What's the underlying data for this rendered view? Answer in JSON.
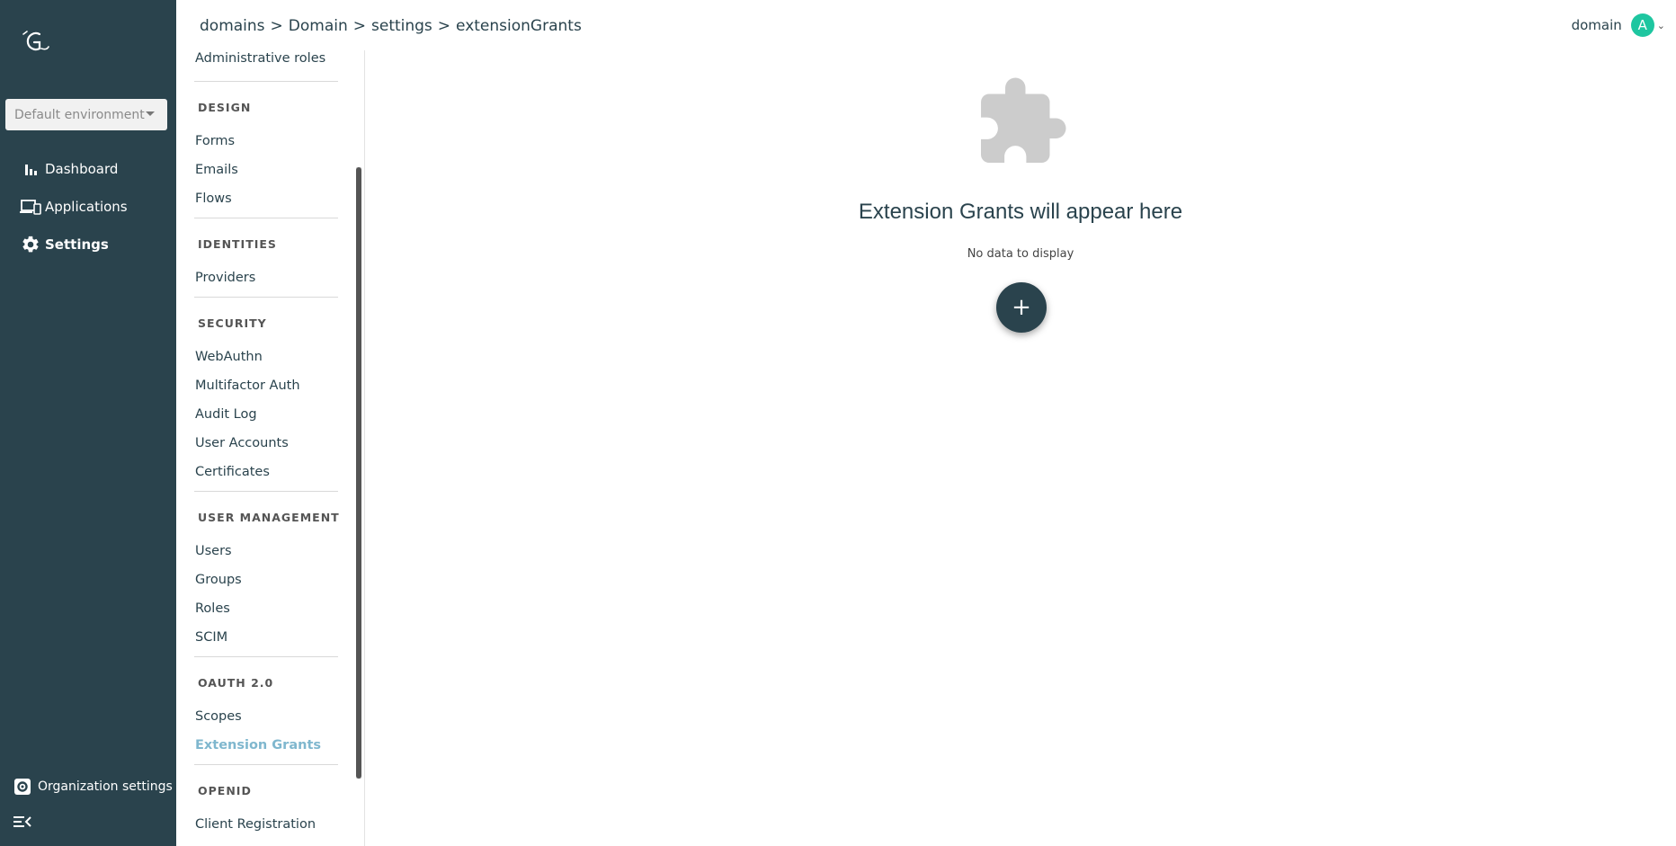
{
  "environment": {
    "selected": "Default environment"
  },
  "main_nav": {
    "dashboard": "Dashboard",
    "applications": "Applications",
    "settings": "Settings"
  },
  "footer": {
    "org_settings": "Organization settings"
  },
  "breadcrumb": [
    "domains",
    "Domain",
    "settings",
    "extensionGrants"
  ],
  "breadcrumb_separator": ">",
  "user": {
    "name": "domain",
    "initial": "A",
    "avatar_color": "#1ec6a0"
  },
  "settings_menu": {
    "top_item": "Administrative roles",
    "design": {
      "title": "DESIGN",
      "items": [
        "Forms",
        "Emails",
        "Flows"
      ]
    },
    "identities": {
      "title": "IDENTITIES",
      "items": [
        "Providers"
      ]
    },
    "security": {
      "title": "SECURITY",
      "items": [
        "WebAuthn",
        "Multifactor Auth",
        "Audit Log",
        "User Accounts",
        "Certificates"
      ]
    },
    "user_management": {
      "title": "USER MANAGEMENT",
      "items": [
        "Users",
        "Groups",
        "Roles",
        "SCIM"
      ]
    },
    "oauth": {
      "title": "OAUTH 2.0",
      "items": [
        "Scopes",
        "Extension Grants"
      ]
    },
    "openid": {
      "title": "OPENID",
      "items": [
        "Client Registration"
      ]
    },
    "active_item": "Extension Grants"
  },
  "empty_state": {
    "title": "Extension Grants will appear here",
    "subtitle": "No data to display",
    "add_button": "+"
  },
  "colors": {
    "sidebar_bg": "#2a434d",
    "active_menu": "#7fb7ce",
    "fab_bg": "#2a434d",
    "icon_gray": "#cccccc"
  },
  "icons": {
    "logo": "gravitee-logo-icon",
    "dashboard": "bar-chart-icon",
    "applications": "devices-icon",
    "settings": "gear-icon",
    "org_settings": "gear-box-icon",
    "collapse": "collapse-menu-icon",
    "empty": "puzzle-piece-icon"
  }
}
